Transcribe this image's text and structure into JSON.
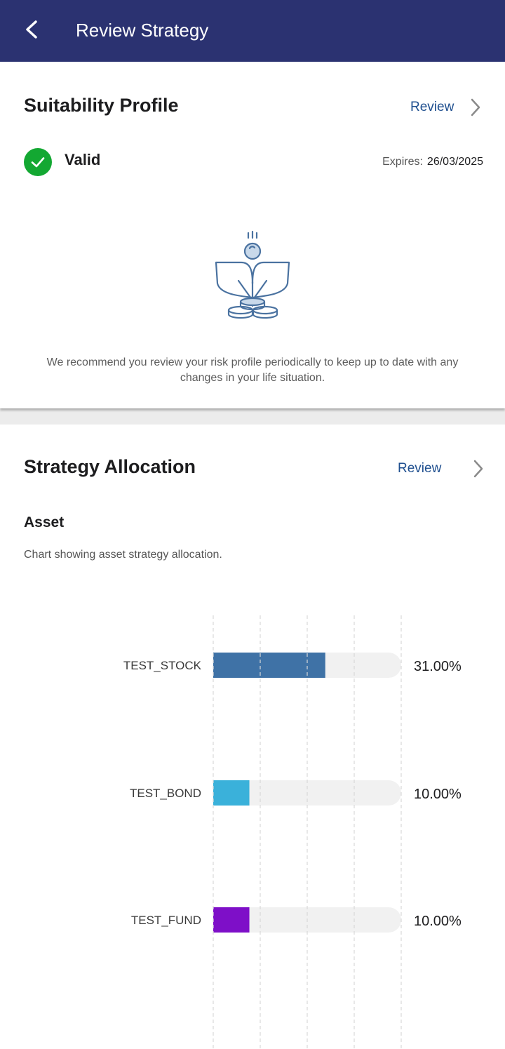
{
  "header": {
    "title": "Review Strategy",
    "back_icon": "chevron-left-icon"
  },
  "suitability": {
    "title": "Suitability Profile",
    "review_label": "Review",
    "status": "Valid",
    "status_color": "#13a832",
    "expires_label": "Expires:",
    "expires_date": "26/03/2025",
    "illustration_icon": "plant-coins-icon",
    "recommendation": "We recommend you review your risk profile periodically to keep up to date with any changes in your life situation."
  },
  "strategy": {
    "title": "Strategy Allocation",
    "review_label": "Review",
    "asset_title": "Asset",
    "chart_description": "Chart showing asset strategy allocation."
  },
  "chart_data": {
    "type": "bar",
    "orientation": "horizontal",
    "categories": [
      "TEST_STOCK",
      "TEST_BOND",
      "TEST_FUND"
    ],
    "values": [
      31.0,
      10.0,
      10.0
    ],
    "value_labels": [
      "31.00%",
      "10.00%",
      "10.00%"
    ],
    "colors": [
      "#3f72a6",
      "#3ab1da",
      "#7e0fc8"
    ],
    "xlim": [
      0,
      52
    ],
    "grid": true
  }
}
